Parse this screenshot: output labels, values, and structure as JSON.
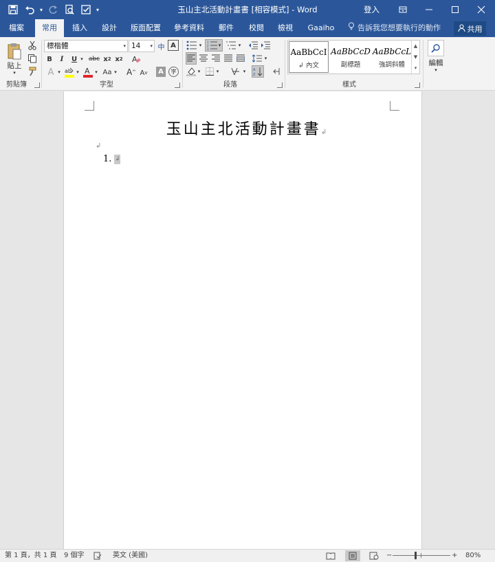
{
  "window": {
    "title": "玉山主北活動計畫書 [相容模式] - Word",
    "signin": "登入"
  },
  "tabs": [
    {
      "label": "檔案"
    },
    {
      "label": "常用"
    },
    {
      "label": "插入"
    },
    {
      "label": "設計"
    },
    {
      "label": "版面配置"
    },
    {
      "label": "參考資料"
    },
    {
      "label": "郵件"
    },
    {
      "label": "校閱"
    },
    {
      "label": "檢視"
    },
    {
      "label": "Gaaiho"
    }
  ],
  "active_tab": "常用",
  "tellme": "告訴我您想要執行的動作",
  "share": "共用",
  "ribbon": {
    "clipboard": {
      "label": "剪貼簿",
      "paste": "貼上"
    },
    "font": {
      "label": "字型",
      "font_name": "標楷體",
      "font_size": "14",
      "grow": "A",
      "shrink": "A",
      "case": "Aa"
    },
    "paragraph": {
      "label": "段落"
    },
    "styles": {
      "label": "樣式",
      "items": [
        {
          "sample": "AaBbCcI",
          "name": "↲ 內文"
        },
        {
          "sample": "AaBbCcD",
          "name": "副標題"
        },
        {
          "sample": "AaBbCcL",
          "name": "強調斜體"
        }
      ]
    },
    "editing": {
      "label": "編輯"
    }
  },
  "document": {
    "heading": "玉山主北活動計畫書",
    "list_number": "1."
  },
  "status": {
    "page": "第 1 頁，共 1 頁",
    "words": "9 個字",
    "language": "英文 (美國)",
    "zoom": "80%",
    "zoom_level": 0.8
  },
  "colors": {
    "accent": "#2b579a",
    "ribbon_bg": "#f3f3f3",
    "canvas_bg": "#e6e6e6"
  }
}
